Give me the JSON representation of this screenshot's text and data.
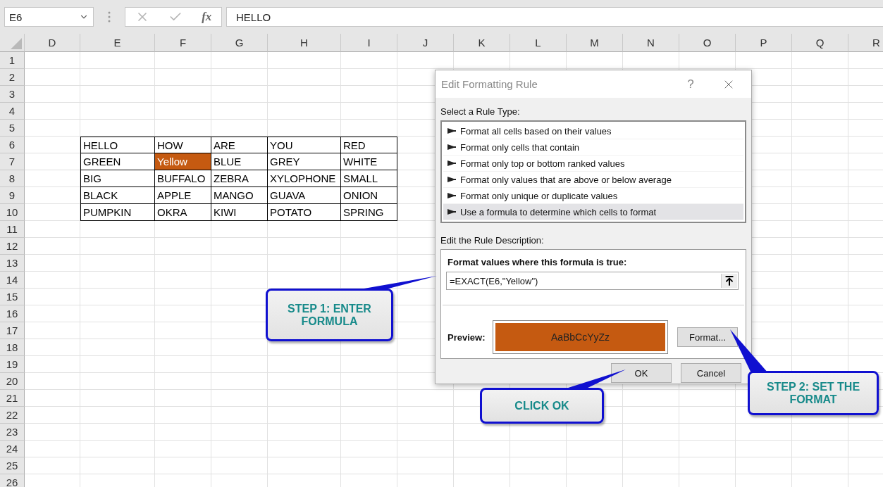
{
  "formula_bar": {
    "name_box": "E6",
    "function_label": "fx",
    "formula": "HELLO"
  },
  "sheet": {
    "columns": [
      "D",
      "E",
      "F",
      "G",
      "H",
      "I",
      "J",
      "K",
      "L",
      "M",
      "N",
      "O",
      "P",
      "Q",
      "R"
    ],
    "row_numbers": [
      "1",
      "2",
      "3",
      "4",
      "5",
      "6",
      "7",
      "8",
      "9",
      "10",
      "11",
      "12",
      "13",
      "14",
      "15",
      "16",
      "17",
      "18",
      "19",
      "20",
      "21",
      "22",
      "23",
      "24",
      "25",
      "26"
    ],
    "data_rows": [
      {
        "cells": [
          {
            "text": "HELLO",
            "highlighted": false
          },
          {
            "text": "HOW",
            "highlighted": false
          },
          {
            "text": "ARE",
            "highlighted": false
          },
          {
            "text": "YOU",
            "highlighted": false
          },
          {
            "text": "RED",
            "highlighted": false
          }
        ]
      },
      {
        "cells": [
          {
            "text": "GREEN",
            "highlighted": false
          },
          {
            "text": "Yellow",
            "highlighted": true
          },
          {
            "text": "BLUE",
            "highlighted": false
          },
          {
            "text": "GREY",
            "highlighted": false
          },
          {
            "text": "WHITE",
            "highlighted": false
          }
        ]
      },
      {
        "cells": [
          {
            "text": "BIG",
            "highlighted": false
          },
          {
            "text": "BUFFALO",
            "highlighted": false
          },
          {
            "text": "ZEBRA",
            "highlighted": false
          },
          {
            "text": "XYLOPHONE",
            "highlighted": false
          },
          {
            "text": "SMALL",
            "highlighted": false
          }
        ]
      },
      {
        "cells": [
          {
            "text": "BLACK",
            "highlighted": false
          },
          {
            "text": "APPLE",
            "highlighted": false
          },
          {
            "text": "MANGO",
            "highlighted": false
          },
          {
            "text": "GUAVA",
            "highlighted": false
          },
          {
            "text": "ONION",
            "highlighted": false
          }
        ]
      },
      {
        "cells": [
          {
            "text": "PUMPKIN",
            "highlighted": false
          },
          {
            "text": "OKRA",
            "highlighted": false
          },
          {
            "text": "KIWI",
            "highlighted": false
          },
          {
            "text": "POTATO",
            "highlighted": false
          },
          {
            "text": "SPRING",
            "highlighted": false
          }
        ]
      }
    ]
  },
  "dialog": {
    "title": "Edit Formatting Rule",
    "help": "?",
    "rule_type_label": "Select a Rule Type:",
    "rule_types": [
      {
        "label": "Format all cells based on their values",
        "selected": false
      },
      {
        "label": "Format only cells that contain",
        "selected": false
      },
      {
        "label": "Format only top or bottom ranked values",
        "selected": false
      },
      {
        "label": "Format only values that are above or below average",
        "selected": false
      },
      {
        "label": "Format only unique or duplicate values",
        "selected": false
      },
      {
        "label": "Use a formula to determine which cells to format",
        "selected": true
      }
    ],
    "description_label": "Edit the Rule Description:",
    "formula_label": "Format values where this formula is true:",
    "formula": "=EXACT(E6,\"Yellow\")",
    "preview_label": "Preview:",
    "preview": {
      "text": "AaBbCcYyZz",
      "color": "#c55a11"
    },
    "format_button": "Format...",
    "buttons": [
      "OK",
      "Cancel"
    ]
  },
  "callouts": [
    {
      "text": "STEP 1: ENTER FORMULA"
    },
    {
      "text": "CLICK OK"
    },
    {
      "text": "STEP 2: SET THE FORMAT"
    }
  ]
}
